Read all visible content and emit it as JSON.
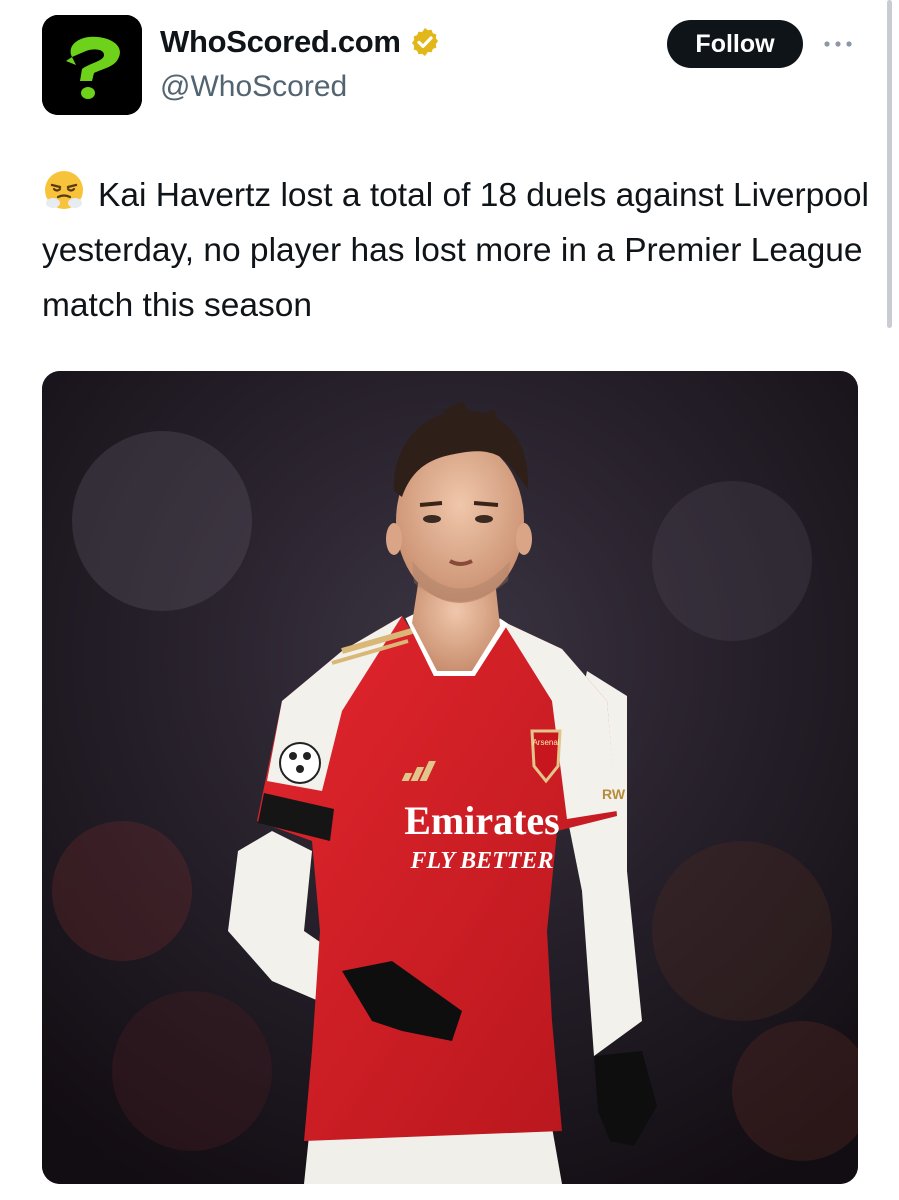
{
  "account": {
    "display_name": "WhoScored.com",
    "handle": "@WhoScored",
    "avatar_icon": "question-mark-logo-icon",
    "verified_icon": "gold-verified-badge-icon"
  },
  "actions": {
    "follow_label": "Follow",
    "more_icon": "more-options-icon"
  },
  "post": {
    "emoji_icon": "steaming-angry-face-emoji",
    "text": "Kai Havertz lost a total of 18 duels against Liverpool yesterday, no player has lost more in a Premier League match this season"
  },
  "media": {
    "shirt_sponsor": "Emirates",
    "shirt_slogan": "FLY BETTER",
    "club_crest_text": "Arsenal",
    "sleeve_sponsor": "RW"
  },
  "colors": {
    "follow_bg": "#0f1419",
    "verified_gold": "#e2b719",
    "avatar_accent": "#6fd21a",
    "shirt_red": "#d8232a",
    "handle_gray": "#536471"
  }
}
